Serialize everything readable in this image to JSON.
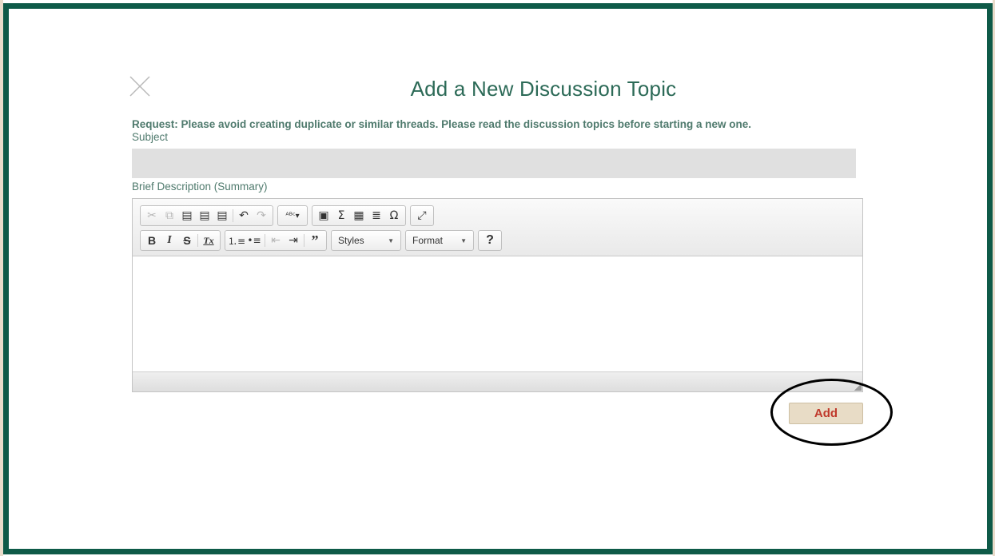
{
  "dialog": {
    "title": "Add a New Discussion Topic",
    "request_note": "Request: Please avoid creating duplicate or similar threads. Please read the discussion topics before starting a new one.",
    "close_icon": "close-icon"
  },
  "form": {
    "subject_label": "Subject",
    "subject_value": "",
    "description_label": "Brief Description (Summary)"
  },
  "editor": {
    "toolbar_row1": [
      {
        "icon": "cut-icon",
        "glyph": "✂",
        "enabled": false
      },
      {
        "icon": "copy-icon",
        "glyph": "⧉",
        "enabled": false
      },
      {
        "icon": "paste-icon",
        "glyph": "📋",
        "enabled": true
      },
      {
        "icon": "paste-text-icon",
        "glyph": "📋",
        "enabled": true
      },
      {
        "icon": "paste-word-icon",
        "glyph": "📋",
        "enabled": true
      },
      {
        "icon": "undo-icon",
        "glyph": "↶",
        "enabled": true
      },
      {
        "icon": "redo-icon",
        "glyph": "↷",
        "enabled": false
      },
      {
        "icon": "spellcheck-icon",
        "glyph": "ᴬᴮᶜ",
        "enabled": true
      },
      {
        "icon": "image-icon",
        "glyph": "▣",
        "enabled": true
      },
      {
        "icon": "math-icon",
        "glyph": "Σ",
        "enabled": true
      },
      {
        "icon": "table-icon",
        "glyph": "▦",
        "enabled": true
      },
      {
        "icon": "horizontal-line-icon",
        "glyph": "≣",
        "enabled": true
      },
      {
        "icon": "special-char-icon",
        "glyph": "Ω",
        "enabled": true
      },
      {
        "icon": "maximize-icon",
        "glyph": "⤢",
        "enabled": true
      }
    ],
    "toolbar_row2": [
      {
        "icon": "bold-icon",
        "glyph": "B"
      },
      {
        "icon": "italic-icon",
        "glyph": "I"
      },
      {
        "icon": "strike-icon",
        "glyph": "S"
      },
      {
        "icon": "remove-format-icon",
        "glyph": "Tx"
      },
      {
        "icon": "numbered-list-icon",
        "glyph": "⒈"
      },
      {
        "icon": "bulleted-list-icon",
        "glyph": "•"
      },
      {
        "icon": "outdent-icon",
        "glyph": "⇤"
      },
      {
        "icon": "indent-icon",
        "glyph": "⇥"
      },
      {
        "icon": "blockquote-icon",
        "glyph": "❞"
      }
    ],
    "styles_label": "Styles",
    "format_label": "Format",
    "help_label": "?",
    "content": ""
  },
  "actions": {
    "add_label": "Add"
  },
  "colors": {
    "frame": "#0e5a48",
    "title": "#2c6a57",
    "label": "#4f7a6d",
    "add_bg": "#e8dcc6",
    "add_text": "#c0392b"
  }
}
